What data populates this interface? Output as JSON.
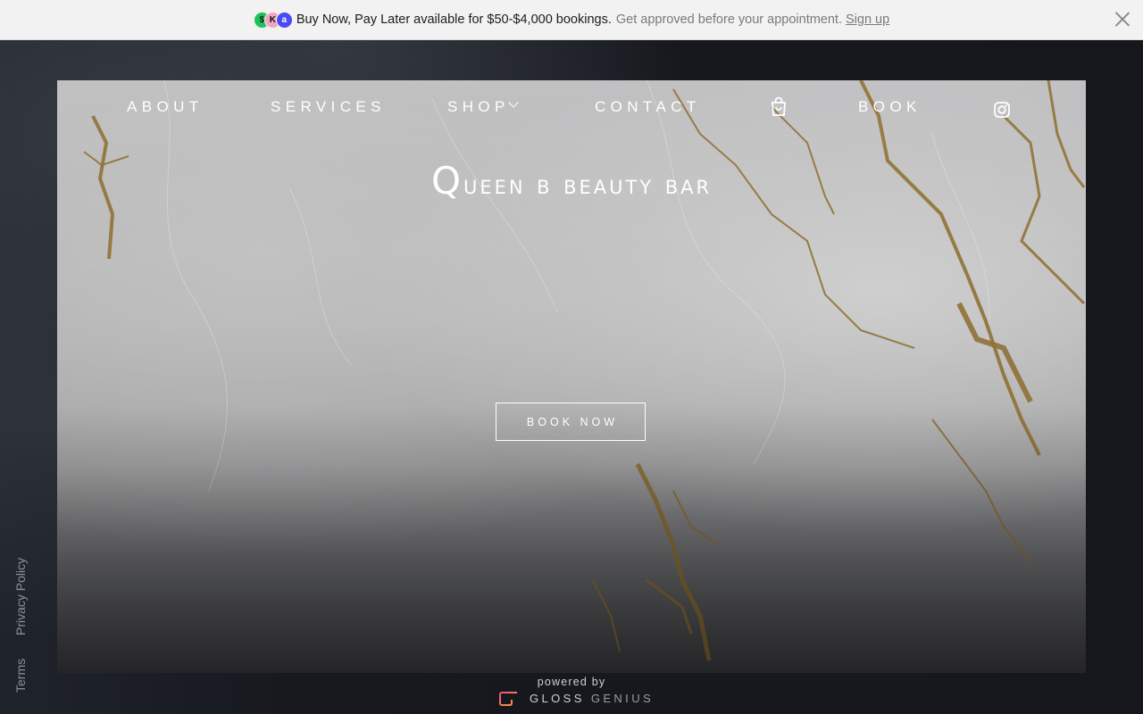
{
  "banner": {
    "pay_icons": [
      "$",
      "K",
      "a"
    ],
    "main_text": "Buy Now, Pay Later available for $50-$4,000 bookings.",
    "sub_text": "Get approved before your appointment.",
    "link_text": "Sign up",
    "close_icon": "close-icon"
  },
  "nav": {
    "items": [
      {
        "label": "ABOUT"
      },
      {
        "label": "SERVICES"
      },
      {
        "label": "SHOP"
      },
      {
        "label": "CONTACT"
      },
      {
        "label": "BOOK"
      }
    ],
    "cart_icon": "shopping-bag-icon",
    "social_icon": "instagram-icon"
  },
  "hero": {
    "title_first": "Q",
    "title_rest": "ueen b beauty bar",
    "cta_label": "BOOK NOW"
  },
  "side_links": {
    "privacy": "Privacy Policy",
    "terms": "Terms"
  },
  "footer": {
    "powered_by": "powered by",
    "brand_part1": "GLOSS",
    "brand_part2": "GENIUS"
  },
  "colors": {
    "accent_gold": "#a8863e",
    "page_background": "#15171c",
    "banner_background": "#f2f2f2"
  }
}
